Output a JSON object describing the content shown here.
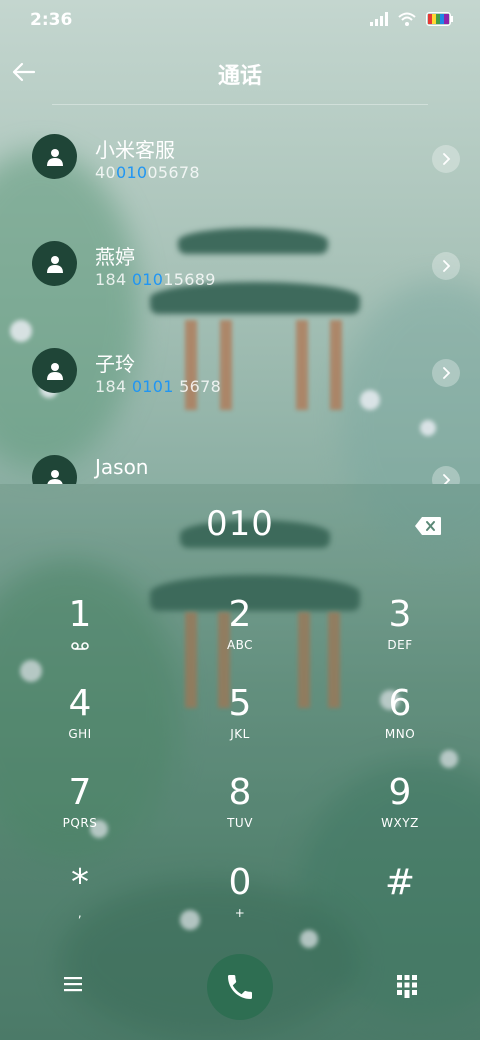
{
  "status_bar": {
    "time": "2:36",
    "icons": [
      "signal-icon",
      "wifi-icon",
      "battery-icon"
    ]
  },
  "header": {
    "title": "通话",
    "back_icon": "arrow-left-icon"
  },
  "contacts": [
    {
      "name": "小米客服",
      "number_pre": "40",
      "number_hl": "010",
      "number_post": "05678"
    },
    {
      "name": "燕婷",
      "number_pre": "184 ",
      "number_hl": "010",
      "number_post": "15689"
    },
    {
      "name": "子玲",
      "number_pre": "184 ",
      "number_hl": "0101",
      "number_post": " 5678"
    },
    {
      "name": "Jason",
      "number_pre": "",
      "number_hl": "",
      "number_post": ""
    }
  ],
  "dialer": {
    "input": "010",
    "keys": [
      {
        "num": "1",
        "letters": "voicemail"
      },
      {
        "num": "2",
        "letters": "ABC"
      },
      {
        "num": "3",
        "letters": "DEF"
      },
      {
        "num": "4",
        "letters": "GHI"
      },
      {
        "num": "5",
        "letters": "JKL"
      },
      {
        "num": "6",
        "letters": "MNO"
      },
      {
        "num": "7",
        "letters": "PQRS"
      },
      {
        "num": "8",
        "letters": "TUV"
      },
      {
        "num": "9",
        "letters": "WXYZ"
      },
      {
        "num": "*",
        "letters": ","
      },
      {
        "num": "0",
        "letters": "+"
      },
      {
        "num": "#",
        "letters": ""
      }
    ]
  },
  "colors": {
    "highlight": "#2196f3",
    "avatar_bg": "#1f4537",
    "call_button": "#2e6e52"
  }
}
